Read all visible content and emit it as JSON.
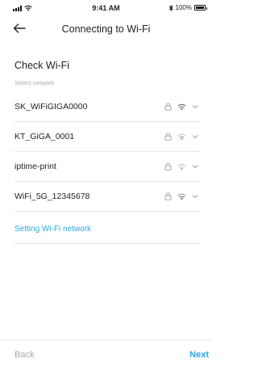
{
  "status_bar": {
    "time": "9:41 AM",
    "battery_label": "100%"
  },
  "nav": {
    "title": "Connecting to Wi-Fi"
  },
  "section": {
    "title": "Check Wi-Fi",
    "subtitle": "Select network"
  },
  "networks": [
    {
      "name": "SK_WiFiGIGA0000"
    },
    {
      "name": "KT_GiGA_0001"
    },
    {
      "name": "iptime-print"
    },
    {
      "name": "WiFi_5G_12345678"
    }
  ],
  "setting_link": "Setting Wi-Fi network",
  "footer": {
    "back_label": "Back",
    "next_label": "Next"
  },
  "colors": {
    "accent": "#2aa8e6",
    "muted": "#a9a9a9"
  }
}
